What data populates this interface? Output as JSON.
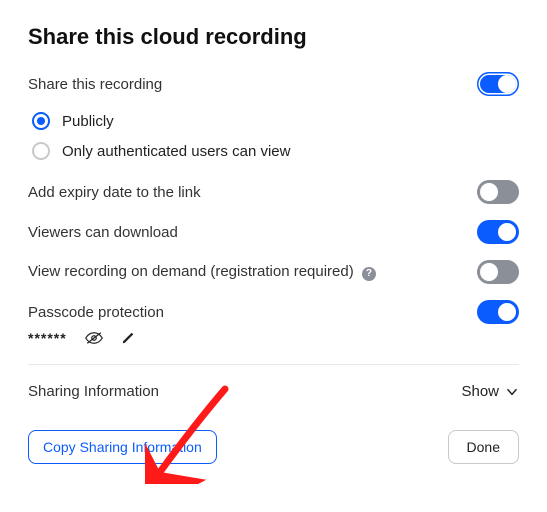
{
  "title": "Share this cloud recording",
  "share_label": "Share this recording",
  "radios": {
    "public": "Publicly",
    "auth_only": "Only authenticated users can view"
  },
  "rows": {
    "expiry": "Add expiry date to the link",
    "download": "Viewers can download",
    "on_demand": "View recording on demand (registration required)",
    "passcode": "Passcode protection"
  },
  "passcode_masked": "******",
  "sharing_info_label": "Sharing Information",
  "show_label": "Show",
  "copy_button": "Copy Sharing Information",
  "done_button": "Done"
}
